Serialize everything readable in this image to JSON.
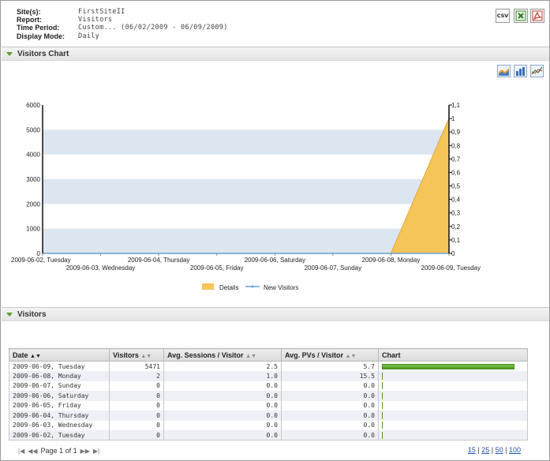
{
  "report_info": {
    "site_label": "Site(s):",
    "site_value": "FirstSiteII",
    "report_label": "Report:",
    "report_value": "Visitors",
    "period_label": "Time Period:",
    "period_value": "Custom... (06/02/2009 - 06/09/2009)",
    "mode_label": "Display Mode:",
    "mode_value": "Daily"
  },
  "exports": {
    "csv": "CSV"
  },
  "sections": {
    "chart_title": "Visitors Chart",
    "table_title": "Visitors"
  },
  "chart_data": {
    "type": "area",
    "categories": [
      "2009-06-02, Tuesday",
      "2009-06-03, Wednesday",
      "2009-06-04, Thursday",
      "2009-06-05, Friday",
      "2009-06-06, Saturday",
      "2009-06-07, Sunday",
      "2009-06-08, Monday",
      "2009-06-09, Tuesday"
    ],
    "series": [
      {
        "name": "Details",
        "values": [
          0,
          0,
          0,
          0,
          0,
          0,
          0,
          5471
        ],
        "color": "#f5c55a",
        "axis": "left"
      },
      {
        "name": "New Visitors",
        "values": [
          0,
          0,
          0,
          0,
          0,
          0,
          0,
          0
        ],
        "color": "#6a9fd4",
        "axis": "right"
      }
    ],
    "y_left_ticks": [
      "0",
      "1000",
      "2000",
      "3000",
      "4000",
      "5000",
      "6000"
    ],
    "y_left_range": [
      0,
      6000
    ],
    "y_right_ticks": [
      "0",
      "0,1",
      "0,2",
      "0,3",
      "0,4",
      "0,5",
      "0,6",
      "0,7",
      "0,8",
      "0,9",
      "1",
      "1,1"
    ],
    "y_right_range": [
      0,
      1.1
    ],
    "grid": "alternating bands",
    "legend": "bottom"
  },
  "table": {
    "headers": [
      "Date",
      "Visitors",
      "Avg. Sessions / Visitor",
      "Avg. PVs / Visitor",
      "Chart"
    ],
    "rows": [
      {
        "date": "2009-06-09, Tuesday",
        "visitors": "5471",
        "sessions": "2.5",
        "pvs": "5.7",
        "bar": 1.0
      },
      {
        "date": "2009-06-08, Monday",
        "visitors": "2",
        "sessions": "1.0",
        "pvs": "15.5",
        "bar": 0.0004
      },
      {
        "date": "2009-06-07, Sunday",
        "visitors": "0",
        "sessions": "0.0",
        "pvs": "0.0",
        "bar": 0
      },
      {
        "date": "2009-06-06, Saturday",
        "visitors": "0",
        "sessions": "0.0",
        "pvs": "0.0",
        "bar": 0
      },
      {
        "date": "2009-06-05, Friday",
        "visitors": "0",
        "sessions": "0.0",
        "pvs": "0.0",
        "bar": 0
      },
      {
        "date": "2009-06-04, Thursday",
        "visitors": "0",
        "sessions": "0.0",
        "pvs": "0.0",
        "bar": 0
      },
      {
        "date": "2009-06-03, Wednesday",
        "visitors": "0",
        "sessions": "0.0",
        "pvs": "0.0",
        "bar": 0
      },
      {
        "date": "2009-06-02, Tuesday",
        "visitors": "0",
        "sessions": "0.0",
        "pvs": "0.0",
        "bar": 0
      }
    ]
  },
  "pager": {
    "text": "Page 1 of 1"
  },
  "page_sizes": [
    "15",
    "25",
    "50",
    "100"
  ]
}
